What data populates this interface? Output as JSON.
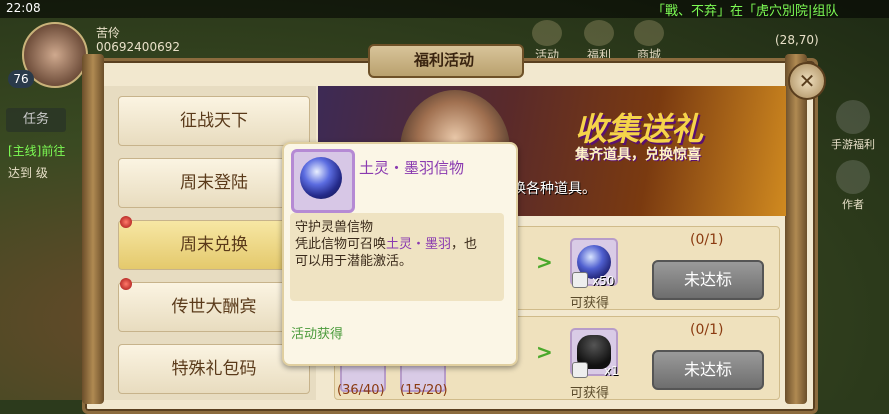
{
  "status_bar": {
    "time": "22:08"
  },
  "ticker": "「戰、不弃」在「虎穴別院|组队",
  "player": {
    "name": "苦伶",
    "id": "00692400692",
    "level": "76"
  },
  "top_icons": [
    {
      "label": "活动",
      "icon": "activity-icon"
    },
    {
      "label": "福利",
      "icon": "gift-icon"
    },
    {
      "label": "商城",
      "icon": "shop-icon"
    }
  ],
  "coords": "(28,70)",
  "left_hud": {
    "task_tab": "任务",
    "quest_line1": "[主线]前往",
    "quest_line2": "达到 级"
  },
  "right_hud": [
    {
      "label": "手游福利",
      "icon": "welfare-icon"
    },
    {
      "label": "作者",
      "icon": "author-icon"
    }
  ],
  "panel": {
    "title": "福利活动",
    "close_glyph": "✕",
    "menu": [
      {
        "label": "征战天下",
        "active": false,
        "dot": false
      },
      {
        "label": "周末登陆",
        "active": false,
        "dot": false
      },
      {
        "label": "周末兑换",
        "active": true,
        "dot": true
      },
      {
        "label": "传世大酬宾",
        "active": false,
        "dot": true
      },
      {
        "label": "特殊礼包码",
        "active": false,
        "dot": false
      }
    ],
    "banner": {
      "title": "收集送礼",
      "subtitle": "集齐道具，兑换惊喜",
      "desc": "换各种道具。"
    },
    "rows": [
      {
        "progress": "(0/1)",
        "qty": "x50",
        "can_get": "可获得",
        "button": "未达标"
      },
      {
        "progress": "(0/1)",
        "qty": "x1",
        "can_get": "可获得",
        "button": "未达标"
      }
    ],
    "bottom_progress": [
      "(36/40)",
      "(15/20)"
    ]
  },
  "tooltip": {
    "name": "土灵・墨羽信物",
    "line1": "守护灵兽信物",
    "line2_a": "凭此信物可召唤",
    "line2_hl": "土灵・墨羽",
    "line2_b": "，也",
    "line3": "可以用于潜能激活。",
    "source": "活动获得"
  },
  "colors": {
    "ticker": "#7dfc54",
    "item_name": "#8a3ab0",
    "source": "#4a9a3a",
    "banner_title": "#f5d44a"
  }
}
